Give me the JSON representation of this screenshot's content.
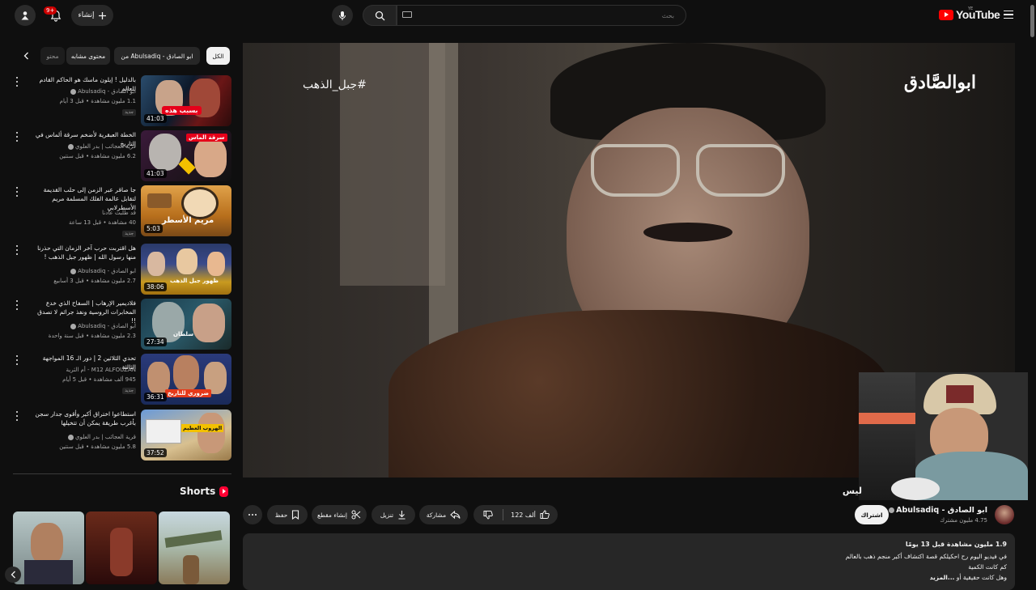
{
  "header": {
    "create_label": "إنشاء",
    "notification_count": "9+",
    "search_placeholder": "بحث",
    "logo_text": "YouTube",
    "logo_region": "YE"
  },
  "chips": [
    {
      "label": "الكل",
      "active": true
    },
    {
      "label": "من Abulsadiq - ابو الصادق",
      "active": false
    },
    {
      "label": "محتوى مشابه",
      "active": false
    },
    {
      "label": "محتو",
      "active": false
    }
  ],
  "related": [
    {
      "title": "بالدليل ! إيلون ماسك هو الحاكم القادم للعالم",
      "channel": "ابو الصادق - Abulsadiq",
      "meta": "1.1 مليون مشاهدة • قبل 3 أيام",
      "badge": "جديد",
      "duration": "41:03",
      "thumb_text": "بسبب هذه"
    },
    {
      "title": "الخطة العبقرية لأضخم سرقة ألماس في التاريخ",
      "channel": "قرية العجائب | بدر العلوي",
      "meta": "6.2 مليون مشاهدة • قبل سنتين",
      "badge": "",
      "duration": "41:03",
      "thumb_text": "سرقة الماس"
    },
    {
      "title": "جا صاقر عبر الزمن إلى حلب القديمة لتقابل عالمة الفلك المسلمة مريم الأسطرلابي",
      "channel": "قد طلبت عادنا",
      "meta": "40 مشاهدة • قبل 13 ساعة",
      "badge": "جديد",
      "duration": "5:03",
      "thumb_text": "مريم الأسطر"
    },
    {
      "title": "هل اقتربت حرب آخر الزمان التي حذرنا منها رسول الله | ظهور جبل الذهب !",
      "channel": "ابو الصادق - Abulsadiq",
      "meta": "2.7 مليون مشاهدة • قبل 3 أسابيع",
      "badge": "",
      "duration": "38:06",
      "thumb_text": "ظهور جبل الذهب"
    },
    {
      "title": "فلاديمير الإرهاب | السفاح الذي خدع المخابرات الروسية ونفذ جرائم لا تصدق !!",
      "channel": "ابو الصادق - Abulsadiq",
      "meta": "2.3 مليون مشاهدة • قبل سنة واحدة",
      "badge": "",
      "duration": "27:34",
      "thumb_text": "سلطان"
    },
    {
      "title": "تحدي الثلاثين 2 | دور الـ 16 المواجهة الثالثة",
      "channel": "M12 ALFOUZAN - أم الثرية",
      "meta": "945 ألف مشاهدة • قبل 5 أيام",
      "badge": "جديد",
      "duration": "36:31",
      "thumb_text": "ضروري للتاريخ"
    },
    {
      "title": "استطاعوا اختراق أكبر وأقوى جدار سجن بأغرب طريقة يمكن أن تتخيلها",
      "channel": "قرية العجائب | بدر العلوي",
      "meta": "5.8 مليون مشاهدة • قبل سنتين",
      "badge": "",
      "duration": "37:52",
      "thumb_text": "الهروب العظيم"
    }
  ],
  "shorts": {
    "title": "Shorts"
  },
  "player": {
    "hashtag": "#جبل_الذهب",
    "brand": "ابوالصَّادق"
  },
  "video": {
    "title": "ليس",
    "like_count": "122 ألف",
    "share_label": "مشاركة",
    "download_label": "تنزيل",
    "clip_label": "إنشاء مقطع",
    "save_label": "حفظ"
  },
  "channel": {
    "name": "ابو الصادق - Abulsadiq",
    "subs": "4.75 مليون مشترك",
    "subscribe_label": "اشتراك"
  },
  "description": {
    "stats": "1.9 مليون مشاهدة  قبل 13 يومًا",
    "line1": "في فيديو اليوم رح احكيلكم قصة اكتشاف أكبر منجم ذهب بالعالم",
    "line2": "كم كانت الكمية",
    "line3": "وهل كانت حقيقية أو",
    "more": "...المزيد"
  }
}
